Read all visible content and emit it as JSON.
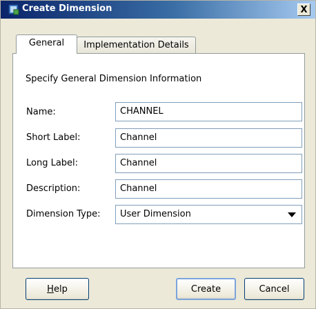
{
  "window": {
    "title": "Create Dimension",
    "close_symbol": "X",
    "app_icon": "dimension-app-icon"
  },
  "tabs": [
    {
      "label": "General",
      "selected": true
    },
    {
      "label": "Implementation Details",
      "selected": false
    }
  ],
  "general": {
    "section_title": "Specify General Dimension Information",
    "fields": {
      "name": {
        "label": "Name:",
        "value": "CHANNEL"
      },
      "short_label": {
        "label": "Short Label:",
        "value": "Channel"
      },
      "long_label": {
        "label": "Long Label:",
        "value": "Channel"
      },
      "description": {
        "label": "Description:",
        "value": "Channel"
      }
    },
    "dimension_type": {
      "label": "Dimension Type:",
      "value": "User Dimension"
    }
  },
  "buttons": {
    "help": "Help",
    "create": "Create",
    "cancel": "Cancel"
  },
  "colors": {
    "title_bar_start": "#0a246a",
    "title_bar_end": "#a6caf0",
    "dialog_background": "#ece9d8",
    "input_border": "#7f9db9"
  }
}
